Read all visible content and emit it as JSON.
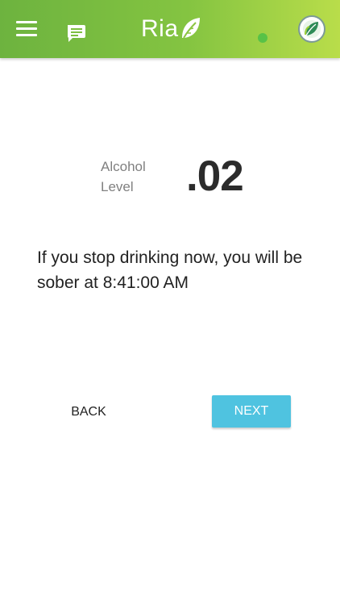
{
  "header": {
    "app_name": "Ria",
    "accent_color": "#7dbf41",
    "icons": {
      "menu": "hamburger-menu-icon",
      "chat": "chat-bubble-icon",
      "logo": "leaf-icon",
      "profile": "leaf-avatar-icon",
      "status": "online-status-dot"
    }
  },
  "reading": {
    "label": "Alcohol Level",
    "value": ".02"
  },
  "message": {
    "text": "If you stop drinking now, you will be sober at 8:41:00 AM"
  },
  "actions": {
    "back_label": "BACK",
    "next_label": "NEXT",
    "next_color": "#4fc3e0"
  }
}
